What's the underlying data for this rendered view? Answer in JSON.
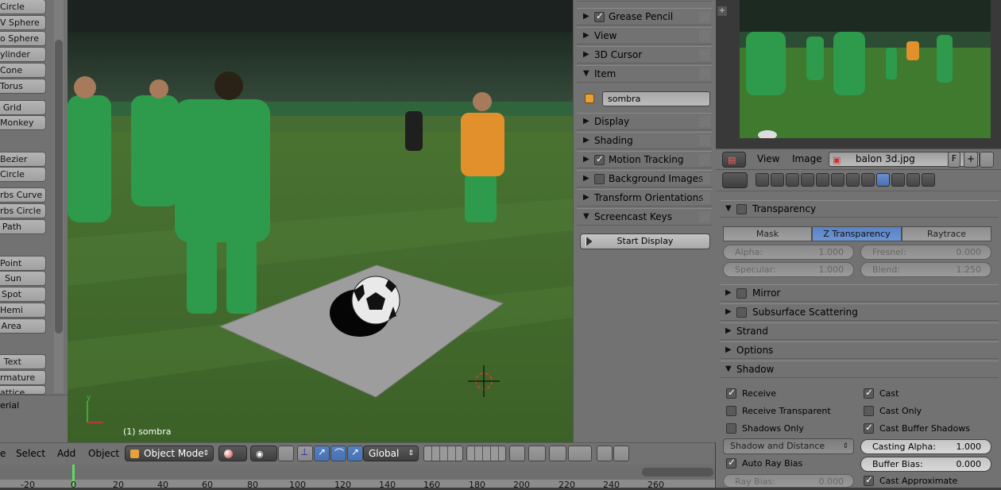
{
  "toolshelf": {
    "items": [
      "Circle",
      "V Sphere",
      "o Sphere",
      "ylinder",
      "Cone",
      "Torus",
      "Grid",
      "Monkey",
      "Bezier",
      "Circle",
      "rbs Curve",
      "rbs Circle",
      "Path",
      "Point",
      "Sun",
      "Spot",
      "Hemi",
      "Area",
      "Text",
      "rmature",
      "attice"
    ],
    "material_label": "erial"
  },
  "viewport": {
    "object_label": "(1) sombra"
  },
  "view_header": {
    "menus": [
      "e",
      "Select",
      "Add",
      "Object"
    ],
    "mode": "Object Mode",
    "orientation": "Global"
  },
  "timeline": {
    "ticks": [
      "-20",
      "0",
      "20",
      "40",
      "60",
      "80",
      "100",
      "120",
      "140",
      "160",
      "180",
      "200",
      "220",
      "240",
      "260"
    ]
  },
  "n_panel": {
    "panels": [
      {
        "label": "Grease Pencil",
        "expanded": false,
        "checkbox": true
      },
      {
        "label": "View",
        "expanded": false
      },
      {
        "label": "3D Cursor",
        "expanded": false
      },
      {
        "label": "Item",
        "expanded": true
      },
      {
        "label": "Display",
        "expanded": false
      },
      {
        "label": "Shading",
        "expanded": false
      },
      {
        "label": "Motion Tracking",
        "expanded": false,
        "checkbox": true
      },
      {
        "label": "Background Images",
        "expanded": false,
        "checkbox": false
      },
      {
        "label": "Transform Orientations",
        "expanded": false
      },
      {
        "label": "Screencast Keys",
        "expanded": true
      }
    ],
    "item_name": "sombra",
    "start_display": "Start Display"
  },
  "image_editor": {
    "menus": [
      "View",
      "Image"
    ],
    "file_name": "balon 3d.jpg",
    "fake_user": "F"
  },
  "material": {
    "transparency": {
      "label": "Transparency",
      "modes": [
        "Mask",
        "Z Transparency",
        "Raytrace"
      ],
      "active_mode": "Z Transparency",
      "alpha_label": "Alpha:",
      "alpha": "1.000",
      "fresnel_label": "Fresnel:",
      "fresnel": "0.000",
      "specular_label": "Specular:",
      "specular": "1.000",
      "blend_label": "Blend:",
      "blend": "1.250"
    },
    "sections": [
      "Mirror",
      "Subsurface Scattering",
      "Strand",
      "Options",
      "Shadow"
    ],
    "shadow": {
      "receive": "Receive",
      "receive_transparent": "Receive Transparent",
      "shadows_only": "Shadows Only",
      "shadow_mode": "Shadow and Distance",
      "auto_ray_bias": "Auto Ray Bias",
      "ray_bias_label": "Ray Bias:",
      "ray_bias": "0.000",
      "cast": "Cast",
      "cast_only": "Cast Only",
      "cast_buffer_shadows": "Cast Buffer Shadows",
      "casting_alpha_label": "Casting Alpha:",
      "casting_alpha": "1.000",
      "buffer_bias_label": "Buffer Bias:",
      "buffer_bias": "0.000",
      "cast_approximate": "Cast Approximate"
    }
  }
}
